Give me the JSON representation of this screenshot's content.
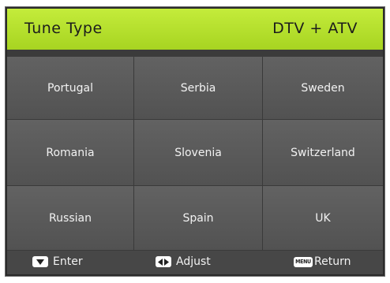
{
  "header": {
    "title": "Tune Type",
    "value": "DTV + ATV"
  },
  "countries": [
    "Portugal",
    "Serbia",
    "Sweden",
    "Romania",
    "Slovenia",
    "Switzerland",
    "Russian",
    "Spain",
    "UK"
  ],
  "footer": {
    "enter_icon": "down-arrow-key-icon",
    "enter_label": "Enter",
    "adjust_icon": "left-right-arrow-key-icon",
    "adjust_label": "Adjust",
    "return_icon_text": "MENU",
    "return_label": "Return"
  },
  "colors": {
    "header_green": "#b5e02e",
    "cell_gray": "#5a5a5a",
    "background": "#2b2b2b",
    "footer": "#474747"
  }
}
